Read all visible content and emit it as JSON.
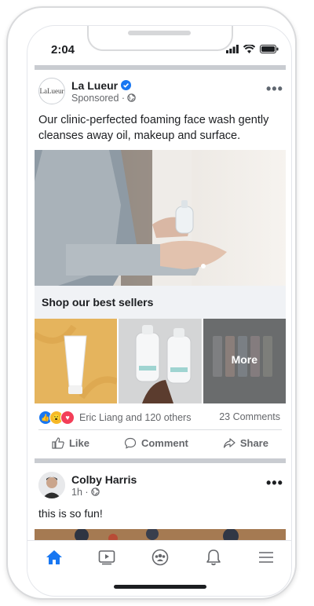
{
  "status_bar": {
    "time": "2:04"
  },
  "post": {
    "advertiser": "La Lueur",
    "logo_text": "LaLueur",
    "sponsored": "Sponsored · ",
    "caption": "Our clinic-perfected foaming face wash gently cleanses away oil, makeup and surface.",
    "shop_label": "Shop our best sellers",
    "carousel_more": "More",
    "reactions_text": "Eric Liang and 120 others",
    "comments_text": "23 Comments",
    "actions": {
      "like": "Like",
      "comment": "Comment",
      "share": "Share"
    }
  },
  "comment_post": {
    "author": "Colby Harris",
    "meta": "1h · ",
    "text": "this is so fun!"
  },
  "colors": {
    "brand_blue": "#1877f2",
    "text_gray": "#65676b",
    "separator": "#c9ccd1"
  },
  "nav": {
    "items": [
      "home-icon",
      "watch-icon",
      "groups-icon",
      "notifications-icon",
      "menu-icon"
    ],
    "active": "home-icon"
  }
}
